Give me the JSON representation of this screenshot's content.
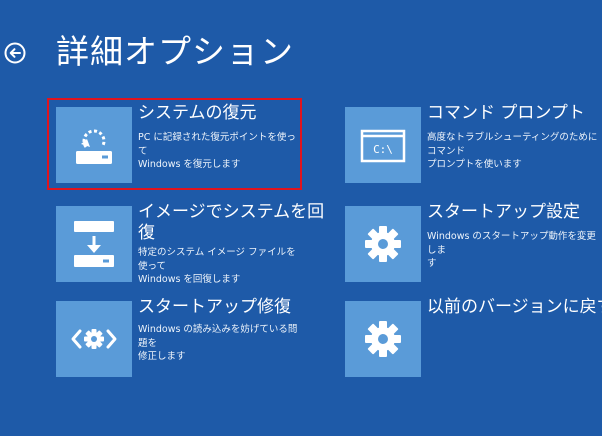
{
  "page": {
    "title": "詳細オプション"
  },
  "colors": {
    "background": "#1e5aa8",
    "tile": "#5a9bd8",
    "highlight": "#e0141e"
  },
  "options": [
    {
      "title": "システムの復元",
      "desc1": "PC に記録された復元ポイントを使って",
      "desc2": "Windows を復元します",
      "icon": "system-restore-icon"
    },
    {
      "title": "コマンド プロンプト",
      "desc1": "高度なトラブルシューティングのためにコマンド",
      "desc2": "プロンプトを使います",
      "icon": "command-prompt-icon"
    },
    {
      "title1": "イメージでシステムを回",
      "title2": "復",
      "desc1": "特定のシステム イメージ ファイルを使って",
      "desc2": "Windows を回復します",
      "icon": "system-image-recovery-icon"
    },
    {
      "title": "スタートアップ設定",
      "desc1": "Windows のスタートアップ動作を変更しま",
      "desc2": "す",
      "icon": "gear-icon"
    },
    {
      "title": "スタートアップ修復",
      "desc1": "Windows の読み込みを妨げている問題を",
      "desc2": "修正します",
      "icon": "startup-repair-icon"
    },
    {
      "title": "以前のバージョンに戻す",
      "icon": "gear-icon"
    }
  ],
  "cmd_icon_text": "C:\\"
}
